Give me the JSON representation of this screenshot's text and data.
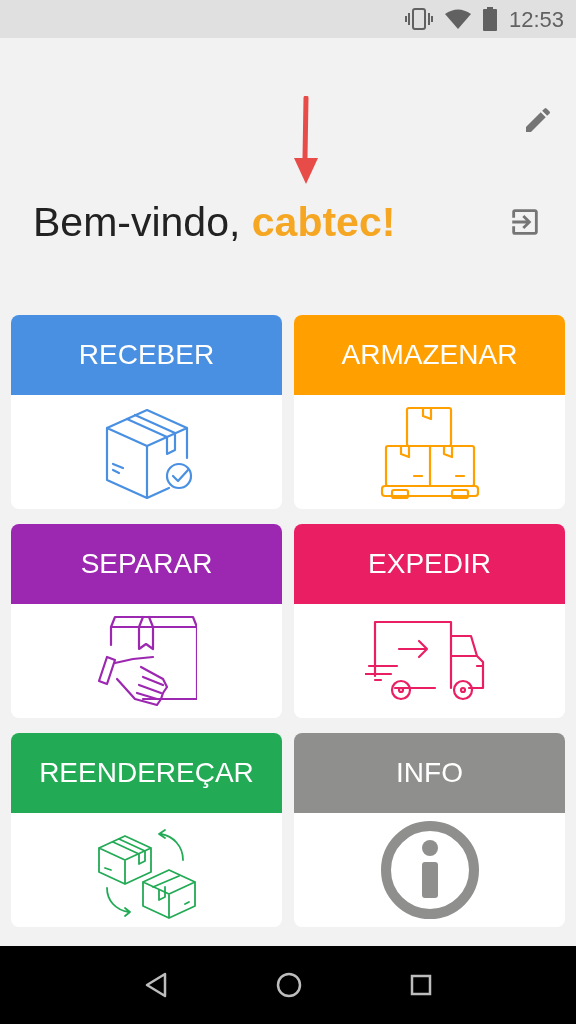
{
  "status_bar": {
    "time": "12:53"
  },
  "header": {
    "greeting": "Bem-vindo,",
    "user": "cabtec!"
  },
  "tiles": [
    {
      "label": "RECEBER",
      "color": "#4a90e2",
      "kind": "receive"
    },
    {
      "label": "ARMAZENAR",
      "color": "#ffa000",
      "kind": "store"
    },
    {
      "label": "SEPARAR",
      "color": "#9c27b0",
      "kind": "pick"
    },
    {
      "label": "EXPEDIR",
      "color": "#e91e63",
      "kind": "ship"
    },
    {
      "label": "REENDEREÇAR",
      "color": "#22aa55",
      "kind": "relocate"
    },
    {
      "label": "INFO",
      "color": "#8f8f8d",
      "kind": "info"
    }
  ]
}
